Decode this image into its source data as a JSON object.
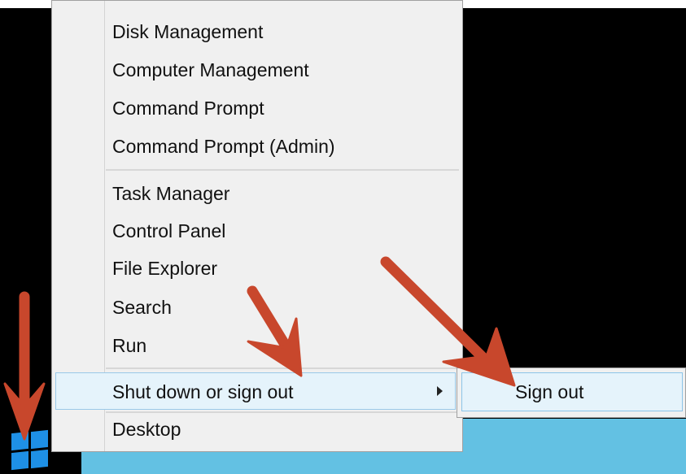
{
  "context_menu": {
    "items": [
      {
        "label": "Disk Management"
      },
      {
        "label": "Computer Management"
      },
      {
        "label": "Command Prompt"
      },
      {
        "label": "Command Prompt (Admin)"
      },
      {
        "label": "Task Manager"
      },
      {
        "label": "Control Panel"
      },
      {
        "label": "File Explorer"
      },
      {
        "label": "Search"
      },
      {
        "label": "Run"
      },
      {
        "label": "Shut down or sign out",
        "has_submenu": true,
        "highlighted": true
      },
      {
        "label": "Desktop"
      }
    ]
  },
  "submenu": {
    "items": [
      {
        "label": "Sign out",
        "highlighted": true
      }
    ]
  },
  "taskbar": {
    "start_icon": "windows-logo-icon"
  },
  "annotations": {
    "arrows": [
      "arrow-to-start-button",
      "arrow-to-shut-down-item",
      "arrow-to-sign-out-item"
    ],
    "arrow_color": "#c8472c"
  },
  "colors": {
    "menu_background": "#f0f0f0",
    "highlight": "#e5f3fb",
    "highlight_border": "#9ac9e8",
    "taskbar": "#63c1e3",
    "start_icon": "#1e90e6"
  }
}
